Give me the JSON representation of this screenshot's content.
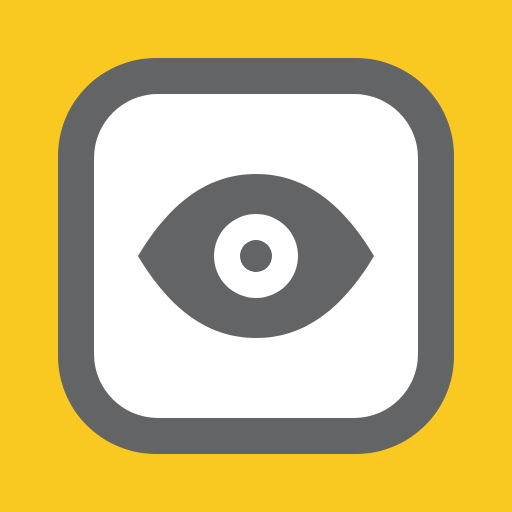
{
  "icon": {
    "name": "eye-icon",
    "colors": {
      "background": "#F9C922",
      "frame": "#636466",
      "panel": "#FFFFFF",
      "eye": "#636466"
    }
  }
}
